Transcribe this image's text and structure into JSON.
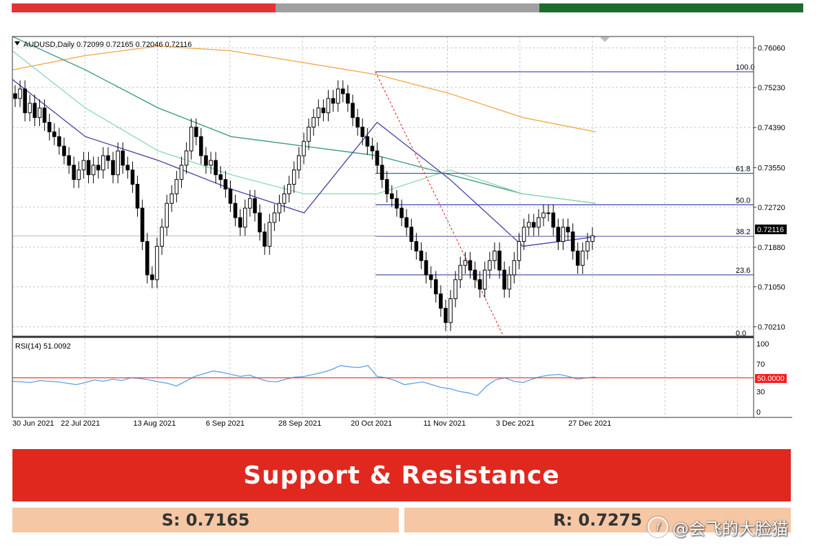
{
  "colors": {
    "bar_red": "#e03535",
    "bar_gray": "#a0a0a0",
    "bar_green": "#1d6b2d",
    "ma_orange": "#f5a94e",
    "ma_teal": "#3f9c87",
    "ma_light_green": "#92dbb4",
    "ma_blue": "#4d4aa8",
    "fib_line": "#4a52b0",
    "trend_dashed": "#e03535",
    "rsi_line": "#5aa0e6",
    "rsi_level": "#ff3333",
    "banner_red": "#e0281f",
    "level_box": "#f5c7a5"
  },
  "chart": {
    "header": "AUDUSD,Daily  0.72099 0.72165 0.72046 0.72116",
    "current_price_label": "0.72116",
    "rsi_header": "RSI(14) 51.0092",
    "rsi_level_label": "50.0000"
  },
  "chart_data": {
    "type": "candlestick",
    "symbol": "AUDUSD",
    "timeframe": "Daily",
    "last_ohlc": {
      "open": 0.72099,
      "high": 0.72165,
      "low": 0.72046,
      "close": 0.72116
    },
    "price_axis_ticks": [
      "0.76060",
      "0.75230",
      "0.74390",
      "0.73550",
      "0.72720",
      "0.71880",
      "0.71050",
      "0.70210"
    ],
    "ylim": [
      0.7,
      0.763
    ],
    "date_labels": [
      "30 Jun 2021",
      "22 Jul 2021",
      "13 Aug 2021",
      "6 Sep 2021",
      "28 Sep 2021",
      "20 Oct 2021",
      "11 Nov 2021",
      "3 Dec 2021",
      "27 Dec 2021"
    ],
    "grid": true,
    "candles_close": [
      0.75,
      0.752,
      0.747,
      0.749,
      0.746,
      0.748,
      0.745,
      0.743,
      0.742,
      0.74,
      0.738,
      0.736,
      0.733,
      0.735,
      0.737,
      0.734,
      0.736,
      0.735,
      0.738,
      0.737,
      0.734,
      0.739,
      0.736,
      0.735,
      0.732,
      0.727,
      0.72,
      0.713,
      0.712,
      0.719,
      0.723,
      0.728,
      0.73,
      0.733,
      0.736,
      0.739,
      0.744,
      0.742,
      0.738,
      0.736,
      0.737,
      0.734,
      0.733,
      0.731,
      0.728,
      0.725,
      0.723,
      0.727,
      0.729,
      0.726,
      0.722,
      0.719,
      0.724,
      0.726,
      0.728,
      0.73,
      0.732,
      0.735,
      0.738,
      0.741,
      0.744,
      0.746,
      0.748,
      0.747,
      0.75,
      0.749,
      0.752,
      0.751,
      0.749,
      0.746,
      0.744,
      0.742,
      0.74,
      0.739,
      0.736,
      0.733,
      0.73,
      0.729,
      0.727,
      0.725,
      0.723,
      0.72,
      0.718,
      0.716,
      0.713,
      0.712,
      0.709,
      0.706,
      0.703,
      0.708,
      0.712,
      0.715,
      0.716,
      0.714,
      0.712,
      0.71,
      0.714,
      0.716,
      0.718,
      0.714,
      0.71,
      0.713,
      0.716,
      0.72,
      0.723,
      0.724,
      0.723,
      0.725,
      0.726,
      0.726,
      0.723,
      0.72,
      0.723,
      0.722,
      0.718,
      0.715,
      0.718,
      0.72,
      0.7212
    ],
    "moving_averages": [
      {
        "color": "orange",
        "values": [
          0.756,
          0.759,
          0.761,
          0.76,
          0.7575,
          0.755,
          0.751,
          0.746,
          0.743
        ]
      },
      {
        "color": "teal",
        "values": [
          0.766,
          0.756,
          0.748,
          0.742,
          0.74,
          0.738,
          0.734,
          0.73,
          0.728
        ]
      },
      {
        "color": "light-green",
        "values": [
          0.76,
          0.748,
          0.739,
          0.734,
          0.73,
          0.73,
          0.735,
          0.73,
          0.728
        ]
      },
      {
        "color": "blue",
        "values": [
          0.754,
          0.742,
          0.737,
          0.731,
          0.726,
          0.745,
          0.733,
          0.719,
          0.721
        ]
      }
    ],
    "fibonacci": [
      {
        "label": "100.0",
        "price": 0.7556
      },
      {
        "label": "61.8",
        "price": 0.7343
      },
      {
        "label": "50.0",
        "price": 0.7277
      },
      {
        "label": "38.2",
        "price": 0.7211
      },
      {
        "label": "23.6",
        "price": 0.713
      },
      {
        "label": "0.0",
        "price": 0.6998
      }
    ],
    "rsi": {
      "period": 14,
      "value": 51.0092,
      "level": 50.0,
      "axis_ticks": [
        "100",
        "70",
        "30",
        "0"
      ],
      "values": [
        45,
        44,
        43,
        46,
        45,
        44,
        42,
        40,
        43,
        47,
        45,
        48,
        46,
        50,
        49,
        47,
        44,
        42,
        38,
        45,
        52,
        56,
        60,
        58,
        55,
        52,
        54,
        49,
        45,
        44,
        48,
        51,
        52,
        55,
        58,
        62,
        68,
        66,
        65,
        68,
        52,
        50,
        46,
        40,
        42,
        44,
        40,
        36,
        34,
        30,
        28,
        24,
        38,
        47,
        50,
        45,
        43,
        48,
        52,
        54,
        55,
        52,
        48,
        50,
        51
      ]
    }
  },
  "support_resistance": {
    "title": "Support & Resistance",
    "support": "S: 0.7165",
    "resistance": "R: 0.7275"
  },
  "watermark": {
    "logo": "f",
    "text": "@会飞的大脸猫"
  }
}
